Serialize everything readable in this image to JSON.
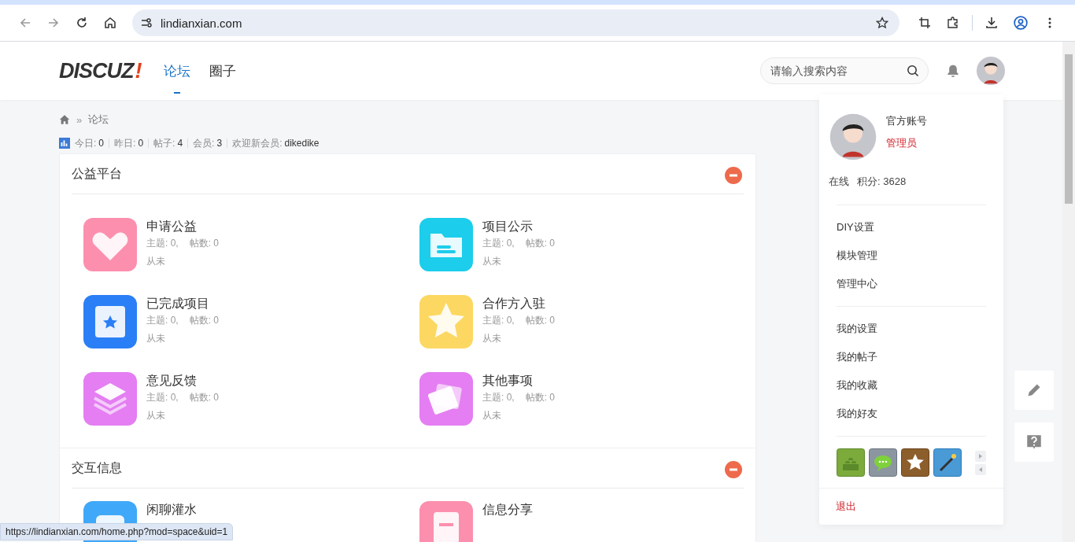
{
  "browser": {
    "url": "lindianxian.com",
    "status_url": "https://lindianxian.com/home.php?mod=space&uid=1"
  },
  "header": {
    "logo": "DISCUZ",
    "logo_mark": "!",
    "nav": [
      {
        "label": "论坛",
        "selected": true
      },
      {
        "label": "圈子",
        "selected": false
      }
    ],
    "search": {
      "placeholder": "请输入搜索内容"
    }
  },
  "breadcrumb": [
    {
      "separator": "»",
      "label": "论坛"
    }
  ],
  "stats": [
    {
      "label": "今日:",
      "value": "0"
    },
    {
      "label": "昨日:",
      "value": "0"
    },
    {
      "label": "帖子:",
      "value": "4"
    },
    {
      "label": "会员:",
      "value": "3"
    },
    {
      "label": "欢迎新会员:",
      "value": "dikedike"
    }
  ],
  "sections": [
    {
      "title": "公益平台",
      "expanded": true,
      "forums": [
        {
          "name": "申请公益",
          "kind": "heart",
          "color": "#fc8fae",
          "topics": "主题: 0,",
          "posts": "帖数: 0",
          "last": "从未"
        },
        {
          "name": "项目公示",
          "kind": "folder",
          "color": "#1ccdec",
          "topics": "主题: 0,",
          "posts": "帖数: 0",
          "last": "从未"
        },
        {
          "name": "已完成项目",
          "kind": "badge",
          "color": "#2a7ff6",
          "topics": "主题: 0,",
          "posts": "帖数: 0",
          "last": "从未"
        },
        {
          "name": "合作方入驻",
          "kind": "star",
          "color": "#fcd862",
          "topics": "主题: 0,",
          "posts": "帖数: 0",
          "last": "从未"
        },
        {
          "name": "意见反馈",
          "kind": "layers",
          "color": "#e47ef2",
          "topics": "主题: 0,",
          "posts": "帖数: 0",
          "last": "从未"
        },
        {
          "name": "其他事项",
          "kind": "cards",
          "color": "#e47ef2",
          "topics": "主题: 0,",
          "posts": "帖数: 0",
          "last": "从未"
        }
      ]
    },
    {
      "title": "交互信息",
      "expanded": true,
      "forums": [
        {
          "name": "闲聊灌水",
          "kind": "chat",
          "color": "#3fa8f8"
        },
        {
          "name": "信息分享",
          "kind": "note",
          "color": "#fc8fae"
        }
      ]
    }
  ],
  "user_menu": {
    "username": "官方账号",
    "role": "管理员",
    "status": "在线",
    "points": "积分: 3628",
    "groups": [
      [
        "DIY设置",
        "模块管理",
        "管理中心"
      ],
      [
        "我的设置",
        "我的帖子",
        "我的收藏",
        "我的好友"
      ]
    ],
    "logout": "退出"
  }
}
